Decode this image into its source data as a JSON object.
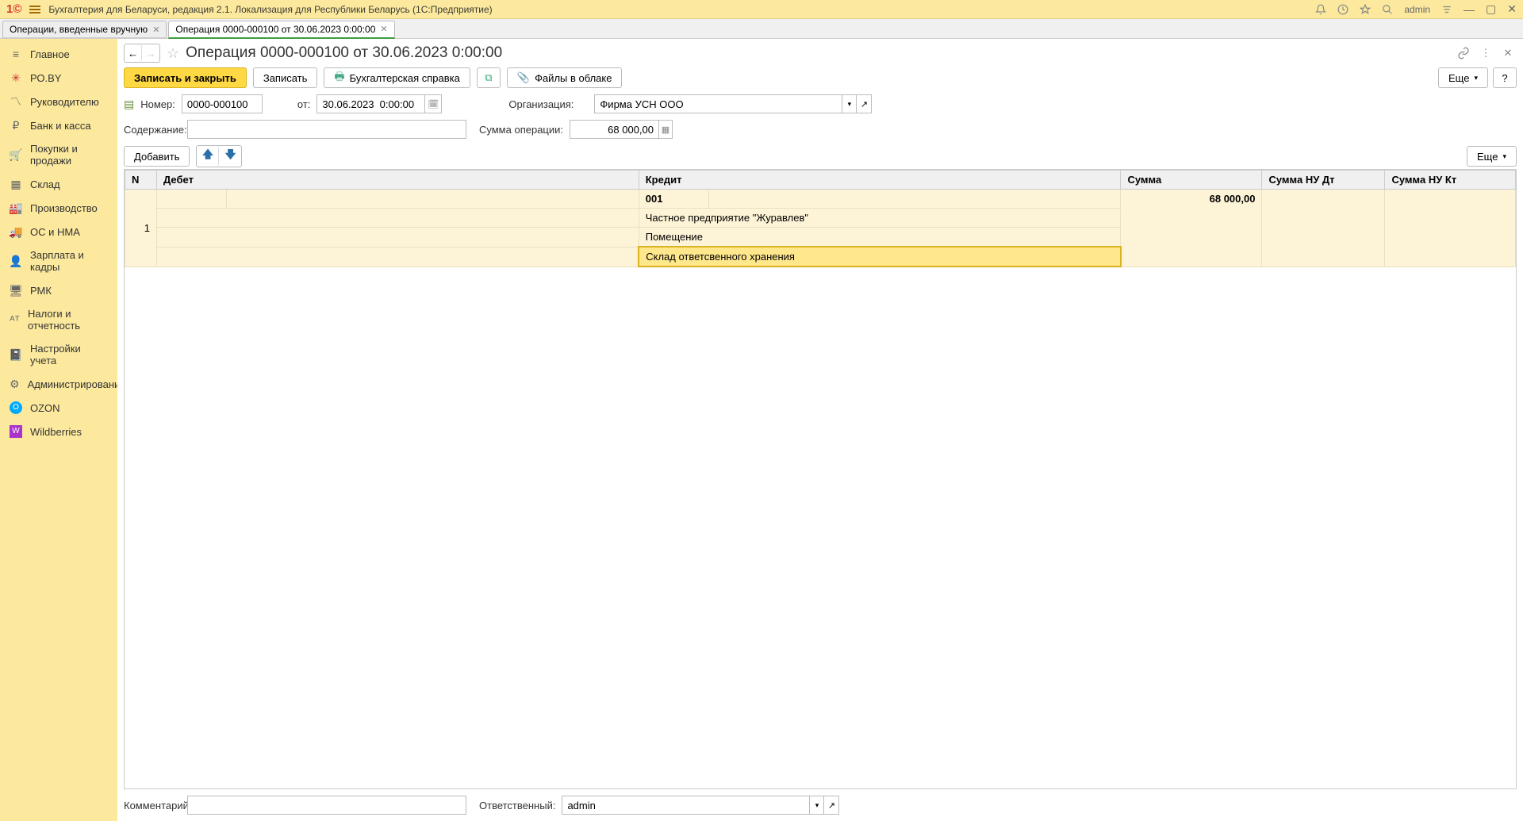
{
  "appTitle": "Бухгалтерия для Беларуси, редакция 2.1. Локализация для Республики Беларусь   (1С:Предприятие)",
  "username": "admin",
  "tabs": [
    {
      "label": "Операции, введенные вручную",
      "active": false
    },
    {
      "label": "Операция 0000-000100 от 30.06.2023 0:00:00",
      "active": true
    }
  ],
  "sidebar": [
    {
      "label": "Главное",
      "icon": "home"
    },
    {
      "label": "РО.BY",
      "icon": "poby"
    },
    {
      "label": "Руководителю",
      "icon": "chart"
    },
    {
      "label": "Банк и касса",
      "icon": "rub"
    },
    {
      "label": "Покупки и продажи",
      "icon": "cart"
    },
    {
      "label": "Склад",
      "icon": "stock"
    },
    {
      "label": "Производство",
      "icon": "factory"
    },
    {
      "label": "ОС и НМА",
      "icon": "truck"
    },
    {
      "label": "Зарплата и кадры",
      "icon": "person"
    },
    {
      "label": "РМК",
      "icon": "rmk"
    },
    {
      "label": "Налоги и отчетность",
      "icon": "tax"
    },
    {
      "label": "Настройки учета",
      "icon": "notebook"
    },
    {
      "label": "Администрирование",
      "icon": "gear"
    },
    {
      "label": "OZON",
      "icon": "ozon"
    },
    {
      "label": "Wildberries",
      "icon": "wb"
    }
  ],
  "pageTitle": "Операция 0000-000100 от 30.06.2023 0:00:00",
  "commands": {
    "saveClose": "Записать и закрыть",
    "save": "Записать",
    "accRef": "Бухгалтерская справка",
    "filesCloud": "Файлы в облаке",
    "more": "Еще",
    "help": "?"
  },
  "form": {
    "numberLabel": "Номер:",
    "numberValue": "0000-000100",
    "fromLabel": "от:",
    "dateValue": "30.06.2023  0:00:00",
    "orgLabel": "Организация:",
    "orgValue": "Фирма УСН ООО",
    "descLabel": "Содержание:",
    "descValue": "",
    "sumLabel": "Сумма операции:",
    "sumValue": "68 000,00",
    "addLabel": "Добавить",
    "commentLabel": "Комментарий:",
    "commentValue": "",
    "respLabel": "Ответственный:",
    "respValue": "admin"
  },
  "tableHeaders": {
    "n": "N",
    "debet": "Дебет",
    "kredit": "Кредит",
    "sum": "Сумма",
    "sumNuDt": "Сумма НУ Дт",
    "sumNuKt": "Сумма НУ Кт"
  },
  "tableRow": {
    "n": "1",
    "kreditAccount": "001",
    "kreditSub1": "Частное предприятие \"Журавлев\"",
    "kreditSub2": "Помещение",
    "kreditSub3": "Склад ответсвенного хранения",
    "sum": "68 000,00"
  }
}
